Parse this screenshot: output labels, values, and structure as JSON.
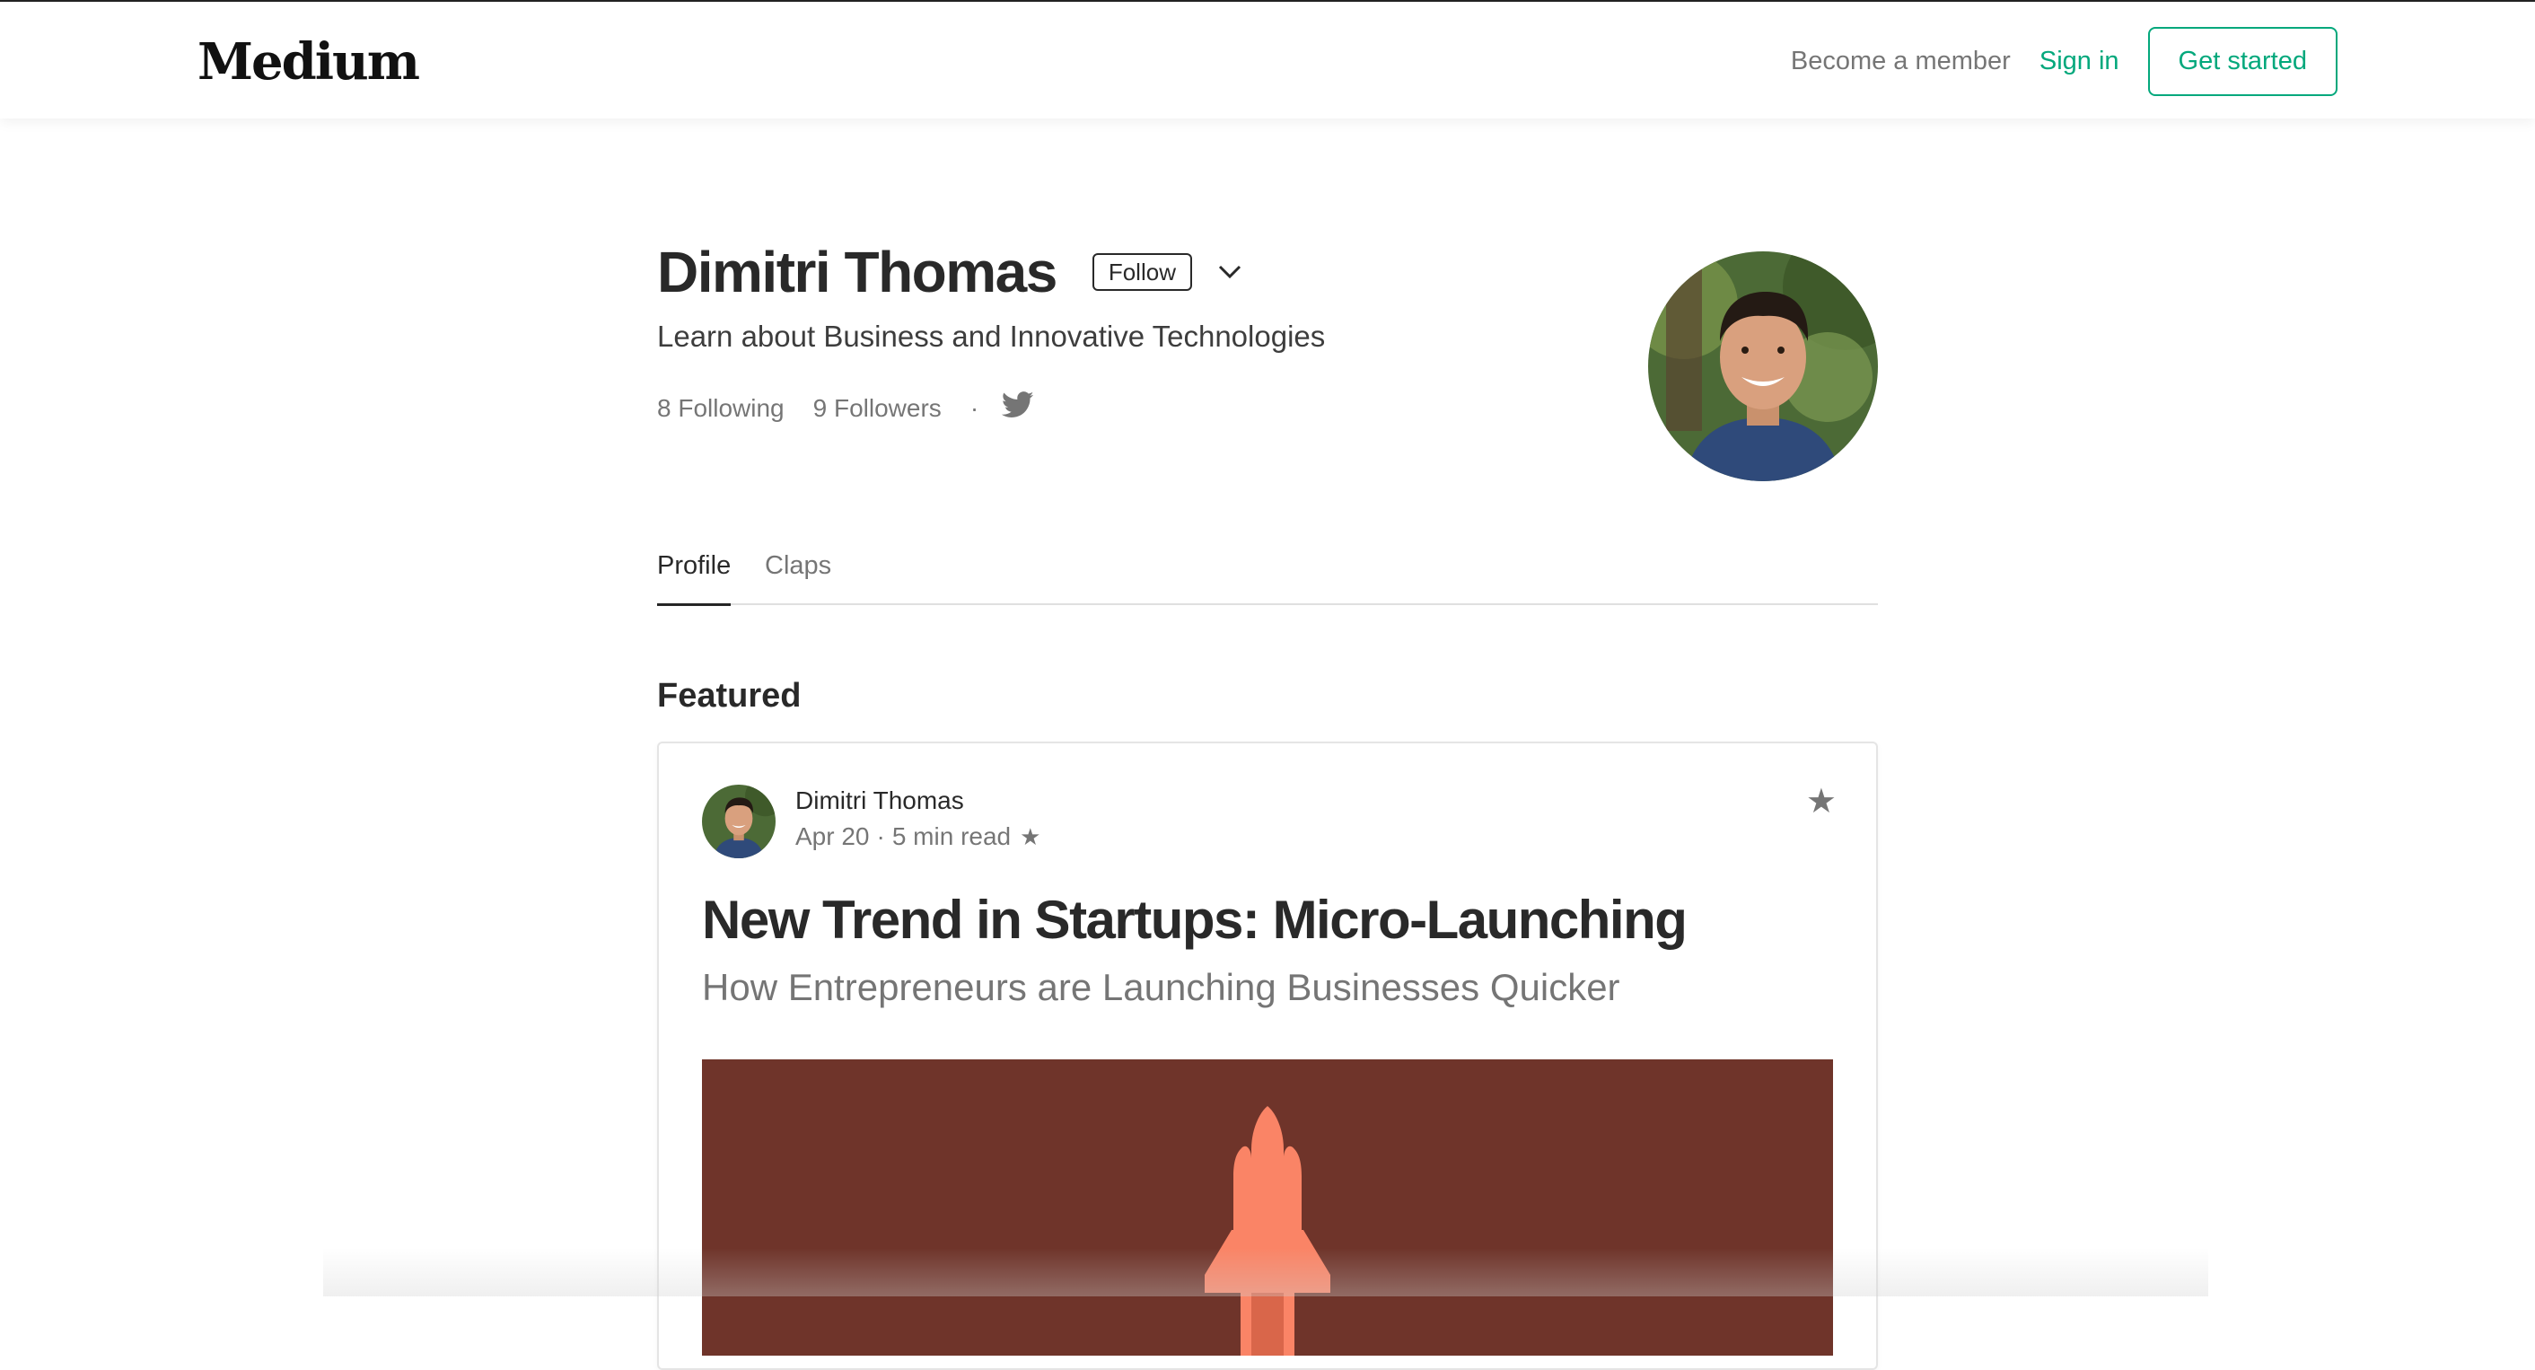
{
  "header": {
    "logo": "Medium",
    "become_member": "Become a member",
    "sign_in": "Sign in",
    "get_started": "Get started"
  },
  "profile": {
    "name": "Dimitri Thomas",
    "follow_label": "Follow",
    "bio": "Learn about Business and Innovative Technologies",
    "following": "8 Following",
    "followers": "9 Followers",
    "separator": "·",
    "social_icon": "twitter-icon",
    "more_icon": "chevron-down-icon"
  },
  "tabs": [
    {
      "label": "Profile",
      "active": true
    },
    {
      "label": "Claps",
      "active": false
    }
  ],
  "featured": {
    "heading": "Featured",
    "post": {
      "author": "Dimitri Thomas",
      "date": "Apr 20",
      "separator": "·",
      "read_time": "5 min read",
      "meta_star": "★",
      "bookmark_star": "★",
      "title": "New Trend in Startups: Micro-Launching",
      "subtitle": "How Entrepreneurs are Launching Businesses Quicker",
      "image_subject": "rocket-illustration"
    }
  },
  "colors": {
    "accent": "#03a87c",
    "image_bg": "#6f342a",
    "rocket": "#fa8466"
  }
}
